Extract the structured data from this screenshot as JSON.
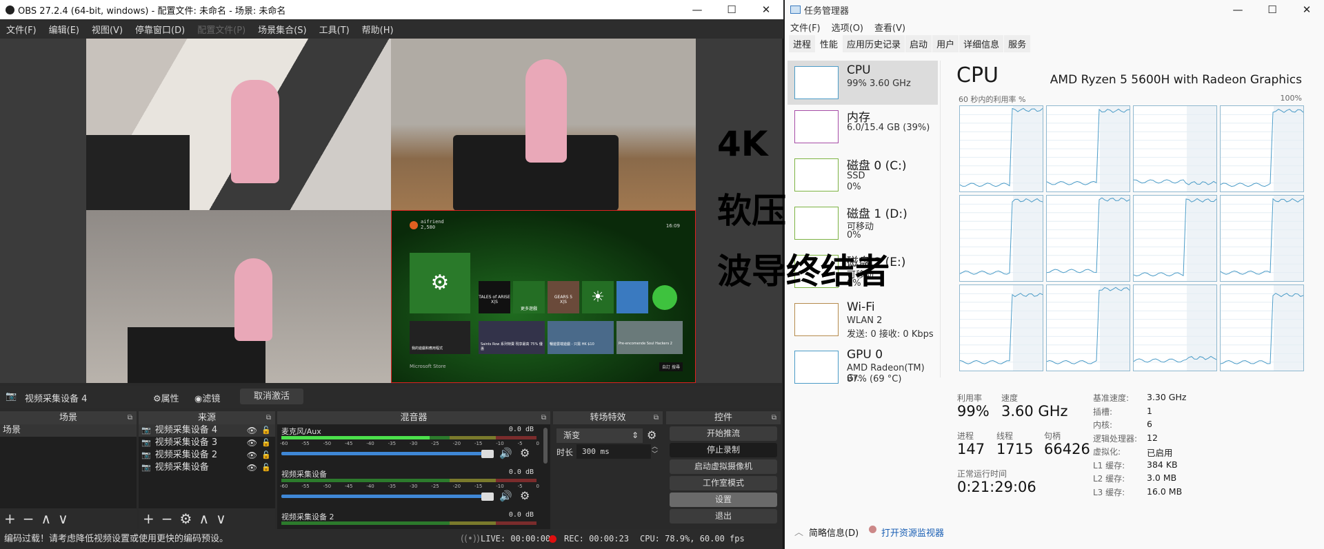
{
  "obs": {
    "title": "OBS 27.2.4 (64-bit, windows) - 配置文件: 未命名 - 场景: 未命名",
    "window_buttons": [
      "—",
      "☐",
      "✕"
    ],
    "menu": [
      "文件(F)",
      "编辑(E)",
      "视图(V)",
      "停靠窗口(D)",
      "配置文件(P)",
      "场景集合(S)",
      "工具(T)",
      "帮助(H)"
    ],
    "overlay_text": [
      "4K",
      "软压",
      "波导终结者"
    ],
    "xbox": {
      "gamertag": "aifriend",
      "score": "2,580",
      "time": "16:09",
      "tiles": [
        "TALES of ARISE",
        "更多遊戲",
        "GEARS 5"
      ],
      "tile_tags": [
        "X|S",
        "X|S"
      ],
      "row2": [
        "我的遊戲和應用程式",
        "Saints Row 系列特賣 現享最高 75% 優惠",
        "暢遊雲端遊戲 - 只需 HK $10",
        "Pre-encomende Soul Hackers 2"
      ],
      "section": "Microsoft Store",
      "footer": [
        "自訂",
        "搜尋"
      ]
    },
    "source_toolbar": {
      "source_name": "视频采集设备 4",
      "properties": "属性",
      "filters": "滤镜",
      "deactivate": "取消激活"
    },
    "scenes": {
      "title": "场景",
      "items": [
        "场景"
      ]
    },
    "sources": {
      "title": "来源",
      "items": [
        "视频采集设备 4",
        "视频采集设备 3",
        "视频采集设备 2",
        "视频采集设备"
      ]
    },
    "mixer": {
      "title": "混音器",
      "scale": [
        "-60",
        "-55",
        "-50",
        "-45",
        "-40",
        "-35",
        "-30",
        "-25",
        "-20",
        "-15",
        "-10",
        "-5",
        "0"
      ],
      "channels": [
        {
          "name": "麦克风/Aux",
          "db": "0.0 dB",
          "level": 0.58,
          "volume": 1.0
        },
        {
          "name": "视频采集设备",
          "db": "0.0 dB",
          "level": 0,
          "volume": 1.0
        },
        {
          "name": "视频采集设备 2",
          "db": "0.0 dB",
          "level": 0,
          "volume": 1.0
        }
      ]
    },
    "transitions": {
      "title": "转场特效",
      "selected": "渐变",
      "duration_label": "时长",
      "duration": "300 ms"
    },
    "controls": {
      "title": "控件",
      "buttons": [
        "开始推流",
        "停止录制",
        "启动虚拟摄像机",
        "工作室模式",
        "设置",
        "退出"
      ]
    },
    "status": {
      "warning": "编码过载！请考虑降低视频设置或使用更快的编码预设。",
      "live": "LIVE: 00:00:00",
      "rec": "REC: 00:00:23",
      "cpu": "CPU: 78.9%, 60.00 fps"
    }
  },
  "taskmgr": {
    "title": "任务管理器",
    "menu": [
      "文件(F)",
      "选项(O)",
      "查看(V)"
    ],
    "tabs": [
      "进程",
      "性能",
      "应用历史记录",
      "启动",
      "用户",
      "详细信息",
      "服务"
    ],
    "active_tab": "性能",
    "items": [
      {
        "name": "CPU",
        "sub": "99% 3.60 GHz",
        "sub2": "",
        "color": "#4a9bc7"
      },
      {
        "name": "内存",
        "sub": "6.0/15.4 GB (39%)",
        "sub2": "",
        "color": "#a64ca6"
      },
      {
        "name": "磁盘 0 (C:)",
        "sub": "SSD",
        "sub2": "0%",
        "color": "#7cb342"
      },
      {
        "name": "磁盘 1 (D:)",
        "sub": "可移动",
        "sub2": "0%",
        "color": "#7cb342"
      },
      {
        "name": "磁盘 2 (E:)",
        "sub": "可移动",
        "sub2": "0%",
        "color": "#7cb342"
      },
      {
        "name": "Wi-Fi",
        "sub": "WLAN 2",
        "sub2": "发送: 0 接收: 0 Kbps",
        "color": "#b58a4c"
      },
      {
        "name": "GPU 0",
        "sub": "AMD Radeon(TM) Gr..",
        "sub2": "87% (69 °C)",
        "color": "#4a9bc7"
      }
    ],
    "cpu": {
      "heading": "CPU",
      "model": "AMD Ryzen 5 5600H with Radeon Graphics",
      "graph_label": "60 秒内的利用率 %",
      "graph_max": "100%",
      "cores_before_after": [
        [
          8,
          97
        ],
        [
          10,
          96
        ],
        [
          12,
          10
        ],
        [
          8,
          96
        ],
        [
          10,
          96
        ],
        [
          12,
          97
        ],
        [
          8,
          96
        ],
        [
          10,
          96
        ],
        [
          10,
          90
        ],
        [
          10,
          97
        ],
        [
          12,
          15
        ],
        [
          10,
          90
        ]
      ],
      "stats": [
        {
          "label": "利用率",
          "value": "99%"
        },
        {
          "label": "速度",
          "value": "3.60 GHz"
        },
        {
          "label": "进程",
          "value": "147"
        },
        {
          "label": "线程",
          "value": "1715"
        },
        {
          "label": "句柄",
          "value": "66426"
        },
        {
          "label": "正常运行时间",
          "value": "0:21:29:06"
        }
      ],
      "details": [
        [
          "基准速度:",
          "3.30 GHz"
        ],
        [
          "插槽:",
          "1"
        ],
        [
          "内核:",
          "6"
        ],
        [
          "逻辑处理器:",
          "12"
        ],
        [
          "虚拟化:",
          "已启用"
        ],
        [
          "L1 缓存:",
          "384 KB"
        ],
        [
          "L2 缓存:",
          "3.0 MB"
        ],
        [
          "L3 缓存:",
          "16.0 MB"
        ]
      ]
    },
    "footer": {
      "fewer": "简略信息(D)",
      "monitor": "打开资源监视器"
    }
  }
}
